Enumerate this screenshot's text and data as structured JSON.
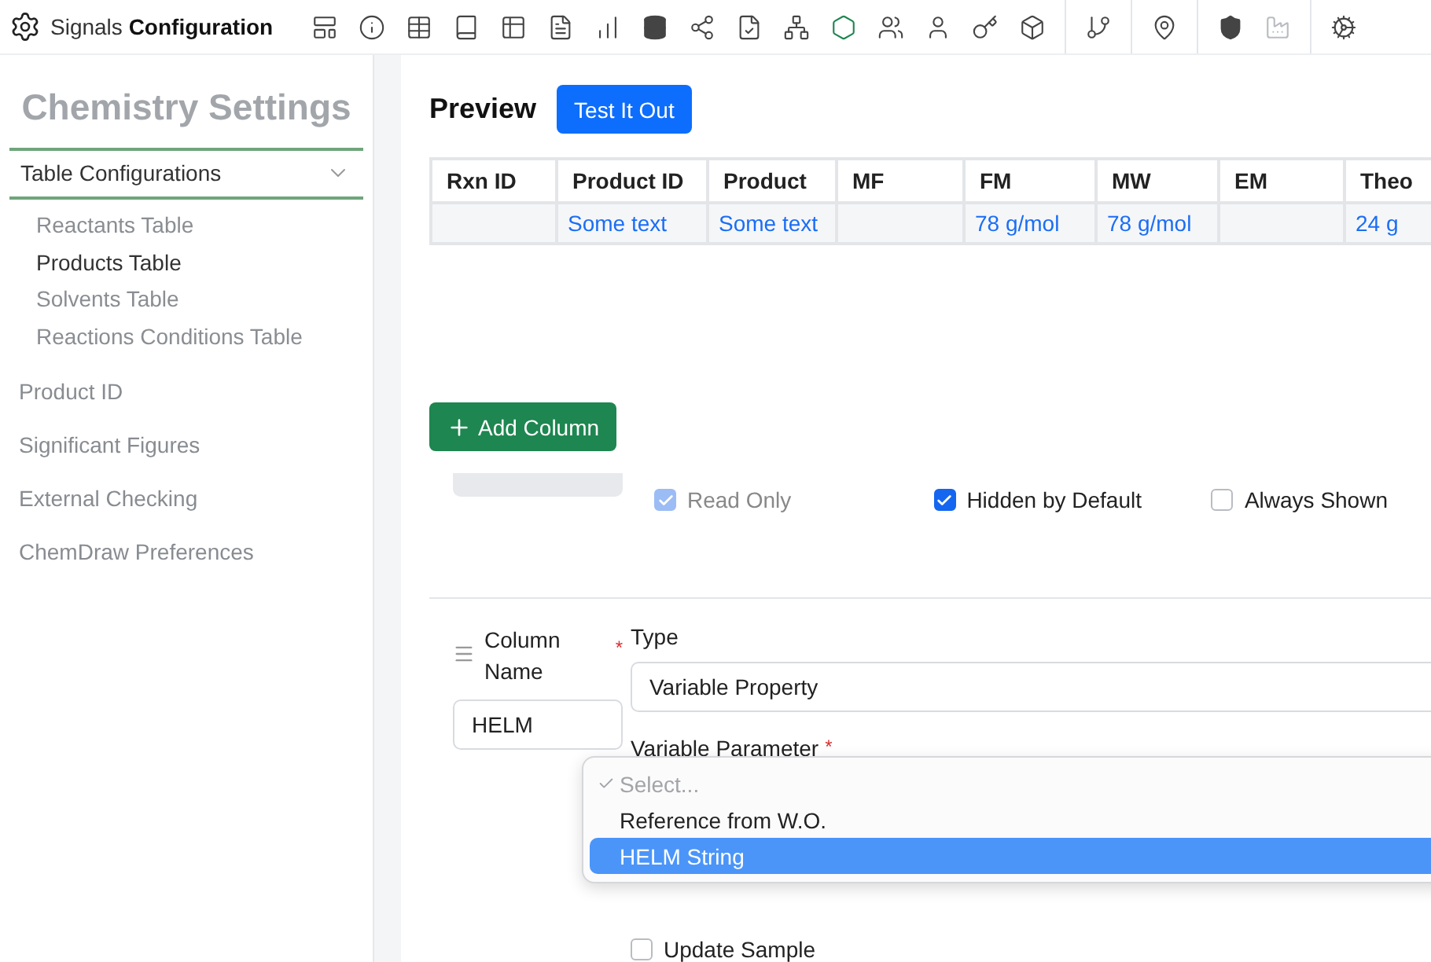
{
  "app": {
    "title_light": "Signals",
    "title_bold": "Configuration"
  },
  "sidebar": {
    "title": "Chemistry Settings",
    "group": {
      "label": "Table Configurations",
      "expanded": true,
      "children": [
        {
          "label": "Reactants Table",
          "selected": false
        },
        {
          "label": "Products Table",
          "selected": true
        },
        {
          "label": "Solvents Table",
          "selected": false
        },
        {
          "label": "Reactions Conditions Table",
          "selected": false
        }
      ]
    },
    "items": [
      {
        "label": "Product ID"
      },
      {
        "label": "Significant Figures"
      },
      {
        "label": "External Checking"
      },
      {
        "label": "ChemDraw Preferences"
      }
    ]
  },
  "preview": {
    "title": "Preview",
    "button": "Test It Out",
    "table": {
      "columns": [
        "Rxn ID",
        "Product ID",
        "Product",
        "MF",
        "FM",
        "MW",
        "EM",
        "Theo"
      ],
      "rows": [
        [
          "",
          "Some text",
          "Some text",
          "",
          "78 g/mol",
          "78 g/mol",
          "",
          "24 g"
        ]
      ]
    }
  },
  "add_column_button": "Add Column",
  "options": [
    {
      "label": "Read Only",
      "checked": true,
      "disabled": true
    },
    {
      "label": "Hidden by Default",
      "checked": true,
      "disabled": false
    },
    {
      "label": "Always Shown",
      "checked": false,
      "disabled": false
    }
  ],
  "column_editor": {
    "name_label": "Column Name",
    "name_required_mark": "*",
    "name_value": "HELM",
    "type_label": "Type",
    "type_value": "Variable Property",
    "parameter_label": "Variable Parameter",
    "parameter_required_mark": "*",
    "dropdown_options": [
      {
        "label": "Select...",
        "kind": "placeholder",
        "checked": true,
        "selected": false
      },
      {
        "label": "Reference from W.O.",
        "kind": "option",
        "checked": false,
        "selected": false
      },
      {
        "label": "HELM String",
        "kind": "option",
        "checked": false,
        "selected": true
      }
    ],
    "update_sample": {
      "label": "Update Sample",
      "checked": false
    }
  }
}
